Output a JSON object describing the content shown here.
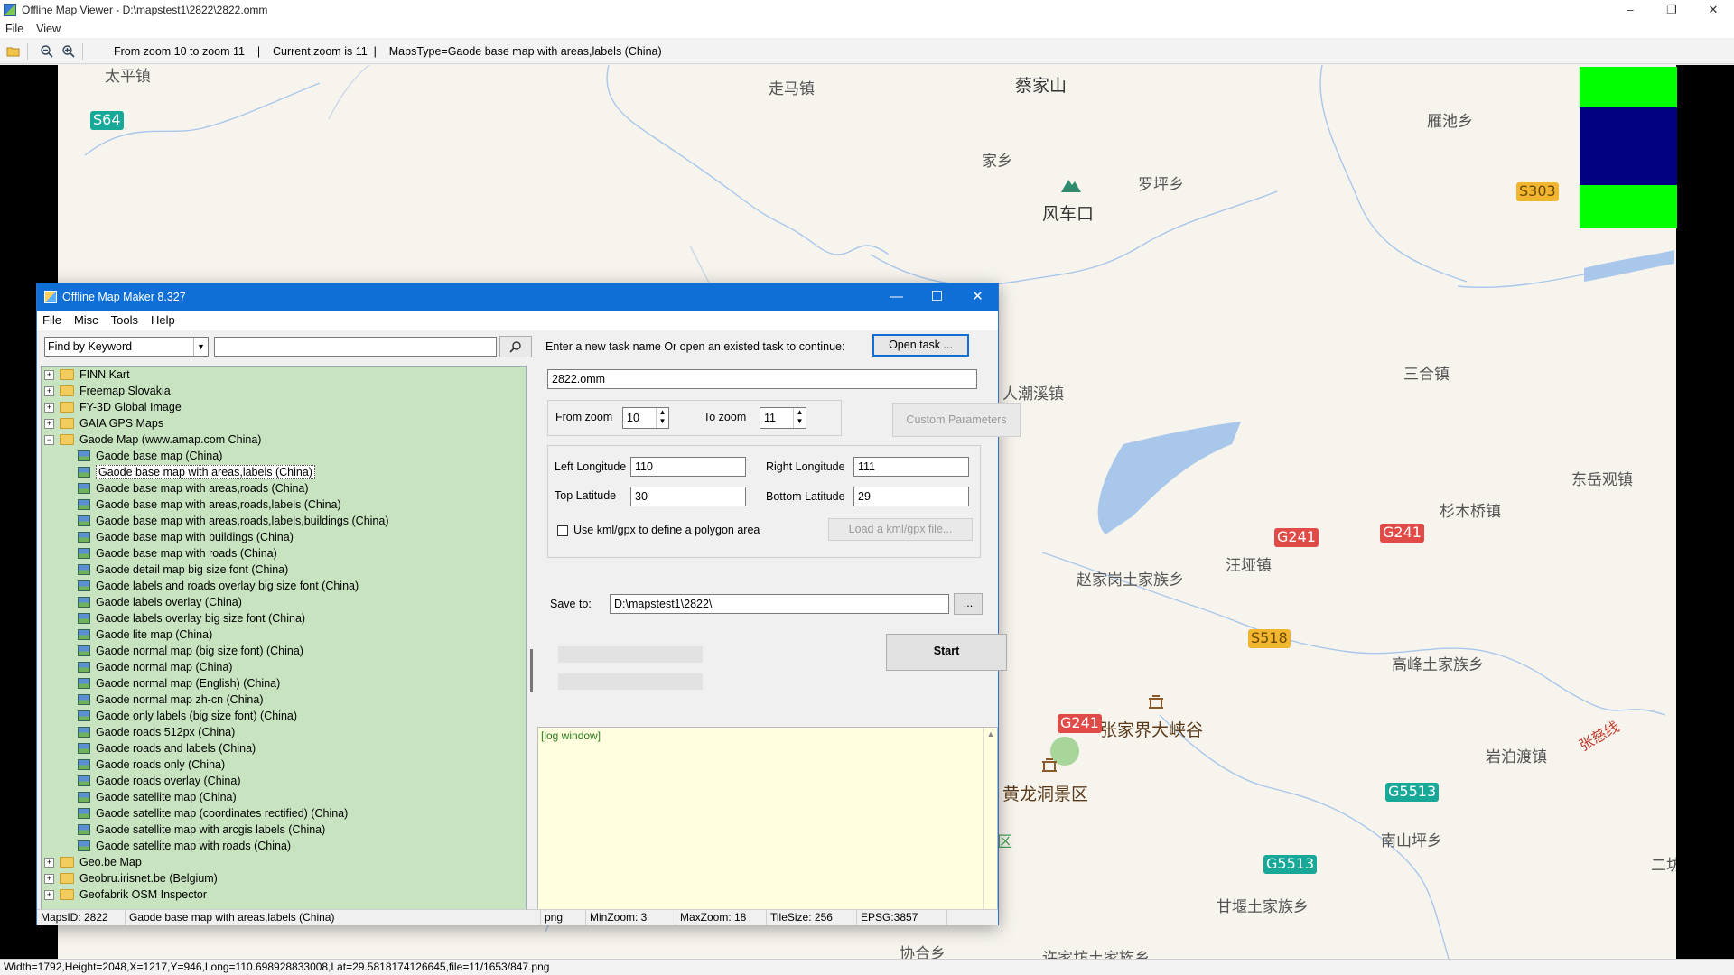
{
  "viewer": {
    "title": "Offline Map Viewer - D:\\mapstest1\\2822\\2822.omm",
    "menu": [
      "File",
      "View"
    ],
    "window_buttons": [
      "–",
      "❐",
      "✕"
    ],
    "toolbar_text": "From zoom 10 to zoom 11    |    Current zoom is 11  |    MapsType=Gaode base map with areas,labels (China)",
    "status": "Width=1792,Height=2048,X=1217,Y=946,Long=110.698928833008,Lat=29.5818174126645,file=11/1653/847.png"
  },
  "map": {
    "places": [
      {
        "text": "太平镇",
        "kind": "normal"
      },
      {
        "text": "走马镇",
        "kind": "normal"
      },
      {
        "text": "蔡家山",
        "kind": "big"
      },
      {
        "text": "雁池乡",
        "kind": "normal"
      },
      {
        "text": "家乡",
        "kind": "normal"
      },
      {
        "text": "罗坪乡",
        "kind": "normal"
      },
      {
        "text": "风车口",
        "kind": "big"
      },
      {
        "text": "人潮溪镇",
        "kind": "normal"
      },
      {
        "text": "三合镇",
        "kind": "normal"
      },
      {
        "text": "东岳观镇",
        "kind": "normal"
      },
      {
        "text": "杉木桥镇",
        "kind": "normal"
      },
      {
        "text": "汪垭镇",
        "kind": "normal"
      },
      {
        "text": "赵家岗土家族乡",
        "kind": "normal"
      },
      {
        "text": "高峰土家族乡",
        "kind": "normal"
      },
      {
        "text": "张家界大峡谷",
        "kind": "scenic"
      },
      {
        "text": "黄龙洞景区",
        "kind": "scenic"
      },
      {
        "text": "岩泊渡镇",
        "kind": "normal"
      },
      {
        "text": "张慈线",
        "kind": "road"
      },
      {
        "text": "南山坪乡",
        "kind": "normal"
      },
      {
        "text": "甘堰土家族乡",
        "kind": "normal"
      },
      {
        "text": "协合乡",
        "kind": "normal"
      },
      {
        "text": "许家坊土家族乡",
        "kind": "normal"
      },
      {
        "text": "二坊",
        "kind": "normal"
      },
      {
        "text": "区",
        "kind": "green"
      }
    ],
    "shields": [
      {
        "text": "S64",
        "color": "teal"
      },
      {
        "text": "S303",
        "color": "yellow"
      },
      {
        "text": "G241",
        "color": "red"
      },
      {
        "text": "G241",
        "color": "red"
      },
      {
        "text": "S518",
        "color": "yellow"
      },
      {
        "text": "G241",
        "color": "red"
      },
      {
        "text": "G5513",
        "color": "teal"
      },
      {
        "text": "G5513",
        "color": "teal"
      }
    ],
    "zoom_indicator_colors": [
      "#00ff00",
      "#000080",
      "#00ff00"
    ]
  },
  "maker": {
    "title": "Offline Map Maker 8.327",
    "window_buttons": [
      "—",
      "☐",
      "✕"
    ],
    "menu": [
      "File",
      "Misc",
      "Tools",
      "Help"
    ],
    "search_mode": "Find by Keyword",
    "search_value": "",
    "tree": [
      {
        "label": "FINN Kart",
        "type": "folder"
      },
      {
        "label": "Freemap Slovakia",
        "type": "folder"
      },
      {
        "label": "FY-3D Global Image",
        "type": "folder"
      },
      {
        "label": "GAIA GPS Maps",
        "type": "folder"
      },
      {
        "label": "Gaode Map (www.amap.com China)",
        "type": "folder-open"
      },
      {
        "label": "Gaode base map (China)",
        "type": "map"
      },
      {
        "label": "Gaode base map with areas,labels (China)",
        "type": "map",
        "selected": true
      },
      {
        "label": "Gaode base map with areas,roads (China)",
        "type": "map"
      },
      {
        "label": "Gaode base map with areas,roads,labels (China)",
        "type": "map"
      },
      {
        "label": "Gaode base map with areas,roads,labels,buildings (China)",
        "type": "map"
      },
      {
        "label": "Gaode base map with buildings (China)",
        "type": "map"
      },
      {
        "label": "Gaode base map with roads (China)",
        "type": "map"
      },
      {
        "label": "Gaode detail map big size font (China)",
        "type": "map"
      },
      {
        "label": "Gaode labels and roads overlay big size font (China)",
        "type": "map"
      },
      {
        "label": "Gaode labels overlay (China)",
        "type": "map"
      },
      {
        "label": "Gaode labels overlay big size font (China)",
        "type": "map"
      },
      {
        "label": "Gaode lite map (China)",
        "type": "map"
      },
      {
        "label": "Gaode normal map (big size font) (China)",
        "type": "map"
      },
      {
        "label": "Gaode normal map (China)",
        "type": "map"
      },
      {
        "label": "Gaode normal map (English) (China)",
        "type": "map"
      },
      {
        "label": "Gaode normal map zh-cn (China)",
        "type": "map"
      },
      {
        "label": "Gaode only labels (big size font) (China)",
        "type": "map"
      },
      {
        "label": "Gaode roads 512px (China)",
        "type": "map"
      },
      {
        "label": "Gaode roads and labels (China)",
        "type": "map"
      },
      {
        "label": "Gaode roads only (China)",
        "type": "map"
      },
      {
        "label": "Gaode roads overlay (China)",
        "type": "map"
      },
      {
        "label": "Gaode satellite map (China)",
        "type": "map"
      },
      {
        "label": "Gaode satellite map (coordinates rectified) (China)",
        "type": "map"
      },
      {
        "label": "Gaode satellite map with arcgis labels (China)",
        "type": "map"
      },
      {
        "label": "Gaode satellite map with roads (China)",
        "type": "map"
      },
      {
        "label": "Geo.be Map",
        "type": "folder"
      },
      {
        "label": "Geobru.irisnet.be (Belgium)",
        "type": "folder"
      },
      {
        "label": "Geofabrik OSM Inspector",
        "type": "folder"
      }
    ],
    "task_prompt": "Enter a new task name Or open an existed task to continue:",
    "open_task_label": "Open task ...",
    "task_name": "2822.omm",
    "from_zoom_label": "From zoom",
    "from_zoom": "10",
    "to_zoom_label": "To zoom",
    "to_zoom": "11",
    "custom_params_label": "Custom Parameters",
    "left_lon_label": "Left Longitude",
    "left_lon": "110",
    "right_lon_label": "Right Longitude",
    "right_lon": "111",
    "top_lat_label": "Top Latitude",
    "top_lat": "30",
    "bottom_lat_label": "Bottom Latitude",
    "bottom_lat": "29",
    "kml_label": "Use kml/gpx to define a polygon area",
    "load_kml_label": "Load a kml/gpx file...",
    "save_to_label": "Save to:",
    "save_to": "D:\\mapstest1\\2822\\",
    "browse_label": "...",
    "start_label": "Start",
    "log_text": "[log window]",
    "status": {
      "maps_id": "MapsID: 2822",
      "maps_name": "Gaode base map with areas,labels (China)",
      "format": "png",
      "min_zoom": "MinZoom: 3",
      "max_zoom": "MaxZoom: 18",
      "tile_size": "TileSize: 256",
      "epsg": "EPSG:3857"
    }
  }
}
